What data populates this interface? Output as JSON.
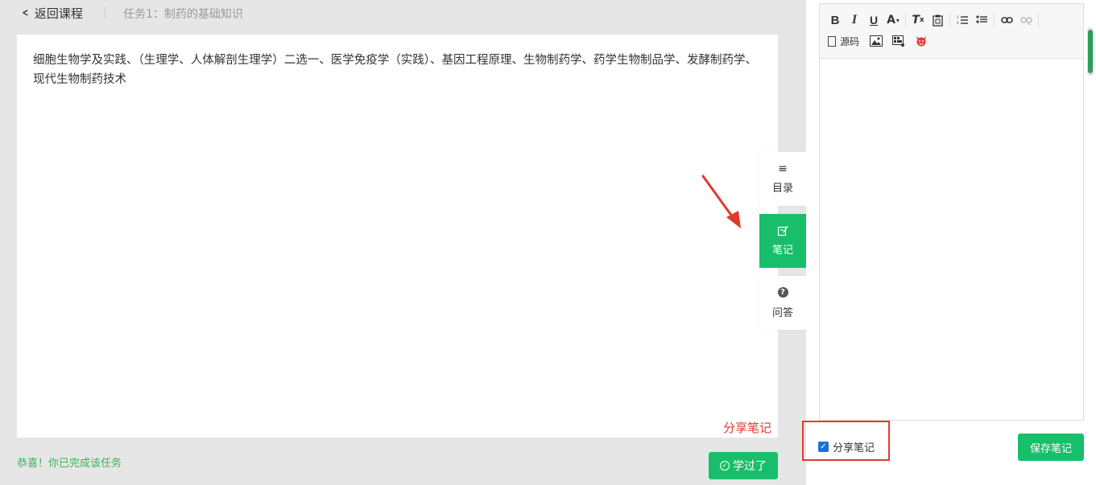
{
  "header": {
    "back_label": "返回课程",
    "task_title": "任务1：制药的基础知识"
  },
  "content": {
    "text": "细胞生物学及实践、（生理学、人体解剖生理学）二选一、医学免疫学（实践）、基因工程原理、生物制药学、药学生物制品学、发酵制药学、现代生物制药技术",
    "share_note_label": "分享笔记"
  },
  "footer": {
    "congrats": "恭喜！你已完成该任务",
    "learned_button": "学过了"
  },
  "side_tabs": {
    "toc": "目录",
    "note": "笔记",
    "qa": "问答"
  },
  "editor": {
    "source_label": "源码"
  },
  "notes": {
    "share_checkbox_label": "分享笔记",
    "share_checked": true,
    "save_button": "保存笔记"
  },
  "colors": {
    "accent_green": "#18bf6a",
    "annotation_red": "#e03a2f",
    "checkbox_blue": "#1e6fd9"
  }
}
